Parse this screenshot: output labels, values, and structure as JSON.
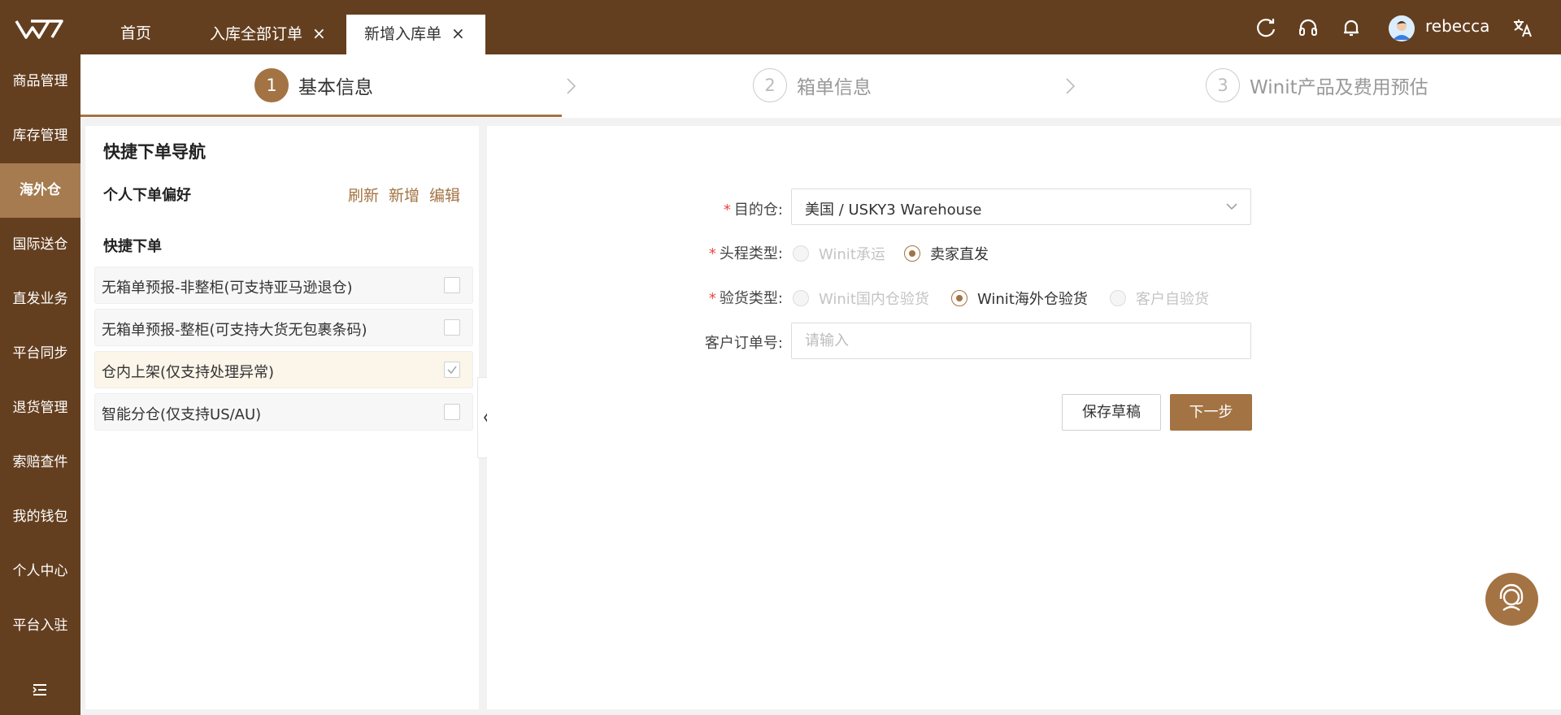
{
  "topbar": {
    "tabs": [
      {
        "label": "首页",
        "closable": false
      },
      {
        "label": "入库全部订单",
        "closable": true
      },
      {
        "label": "新增入库单",
        "closable": true,
        "active": true
      }
    ],
    "close_glyph": "×",
    "username": "rebecca",
    "icons": [
      "refresh-icon",
      "headset-icon",
      "bell-icon",
      "translate-icon"
    ]
  },
  "sidebar": {
    "items": [
      "商品管理",
      "库存管理",
      "海外仓",
      "国际送仓",
      "直发业务",
      "平台同步",
      "退货管理",
      "索赔查件",
      "我的钱包",
      "个人中心",
      "平台入驻"
    ],
    "active_index": 2
  },
  "steps": [
    {
      "num": "1",
      "label": "基本信息",
      "active": true
    },
    {
      "num": "2",
      "label": "箱单信息",
      "active": false
    },
    {
      "num": "3",
      "label": "Winit产品及费用预估",
      "active": false
    }
  ],
  "quick_nav": {
    "title": "快捷下单导航",
    "pref_label": "个人下单偏好",
    "actions": [
      "刷新",
      "新增",
      "编辑"
    ],
    "quick_label": "快捷下单",
    "items": [
      {
        "label": "无箱单预报-非整柜(可支持亚马逊退仓)",
        "checked": false
      },
      {
        "label": "无箱单预报-整柜(可支持大货无包裹条码)",
        "checked": false
      },
      {
        "label": "仓内上架(仅支持处理异常)",
        "checked": true
      },
      {
        "label": "智能分仓(仅支持US/AU)",
        "checked": false
      }
    ]
  },
  "form": {
    "required_mark": "*",
    "warehouse": {
      "label": "目的仓:",
      "value": "美国 / USKY3 Warehouse"
    },
    "head_type": {
      "label": "头程类型:",
      "options": [
        {
          "label": "Winit承运",
          "selected": false
        },
        {
          "label": "卖家直发",
          "selected": true
        }
      ]
    },
    "inspect_type": {
      "label": "验货类型:",
      "options": [
        {
          "label": "Winit国内仓验货",
          "selected": false
        },
        {
          "label": "Winit海外仓验货",
          "selected": true
        },
        {
          "label": "客户自验货",
          "selected": false
        }
      ]
    },
    "order_no": {
      "label": "客户订单号:",
      "placeholder": "请输入",
      "value": ""
    },
    "save_draft": "保存草稿",
    "next": "下一步"
  },
  "colors": {
    "brand_dark": "#643f1f",
    "accent": "#a37343",
    "sidebar_active": "#a57b4f"
  }
}
